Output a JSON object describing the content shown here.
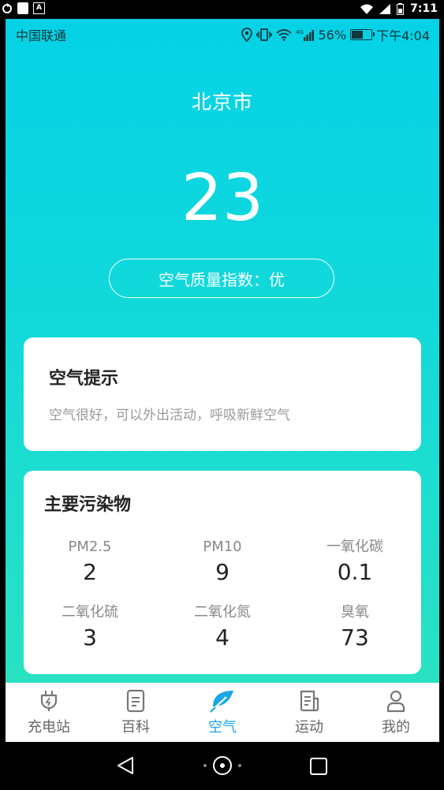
{
  "system_bar": {
    "time": "7:11"
  },
  "status": {
    "carrier": "中国联通",
    "network": "4G",
    "battery": "56%",
    "time": "下午4:04"
  },
  "city": "北京市",
  "aqi": "23",
  "quality_label": "空气质量指数：优",
  "tip": {
    "title": "空气提示",
    "text": "空气很好，可以外出活动，呼吸新鲜空气"
  },
  "pollutants": {
    "title": "主要污染物",
    "items": [
      {
        "name": "PM2.5",
        "value": "2"
      },
      {
        "name": "PM10",
        "value": "9"
      },
      {
        "name": "一氧化碳",
        "value": "0.1"
      },
      {
        "name": "二氧化硫",
        "value": "3"
      },
      {
        "name": "二氧化氮",
        "value": "4"
      },
      {
        "name": "臭氧",
        "value": "73"
      }
    ]
  },
  "tabs": [
    {
      "label": "充电站",
      "icon": "charging-plug-icon",
      "active": false
    },
    {
      "label": "百科",
      "icon": "document-icon",
      "active": false
    },
    {
      "label": "空气",
      "icon": "leaf-icon",
      "active": true
    },
    {
      "label": "运动",
      "icon": "article-icon",
      "active": false
    },
    {
      "label": "我的",
      "icon": "person-icon",
      "active": false
    }
  ],
  "colors": {
    "gradient_top": "#05d2e6",
    "gradient_bottom": "#2ee3be",
    "active_tab": "#1aa7e8",
    "inactive_tab": "#666666"
  }
}
